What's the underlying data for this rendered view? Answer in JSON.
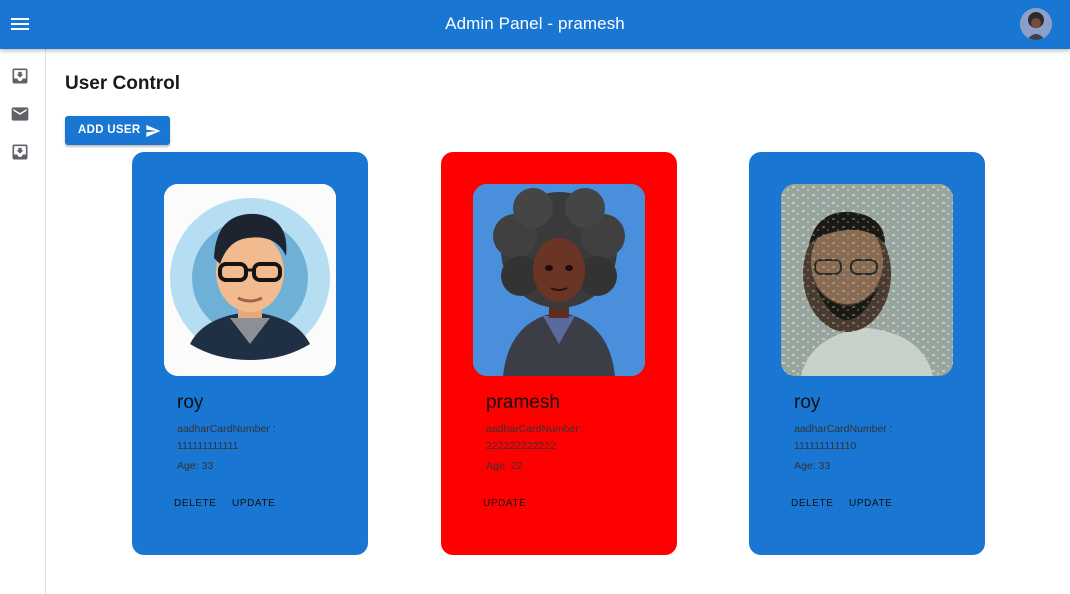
{
  "appbar": {
    "title": "Admin Panel - pramesh",
    "menu_icon": "hamburger-menu-icon",
    "avatar_icon": "user-avatar-icon",
    "color": "#1976d2"
  },
  "drawer": {
    "items": [
      {
        "icon": "move-to-inbox-icon"
      },
      {
        "icon": "mail-icon"
      },
      {
        "icon": "move-to-inbox-icon"
      }
    ]
  },
  "main": {
    "title": "User Control",
    "add_user_label": "ADD USER",
    "add_user_icon": "send-icon"
  },
  "users": [
    {
      "name": "roy",
      "aadhar_label": "aadharCardNumber :",
      "aadhar_value": "111111111111",
      "age_label": "Age:",
      "age": "33",
      "delete_label": "DELETE",
      "update_label": "UPDATE",
      "card_color": "#1976d2",
      "photo": "cartoon-man-glasses-avatar"
    },
    {
      "name": "pramesh",
      "aadhar_label": "aadharCardNumber :",
      "aadhar_value": "222222222222",
      "age_label": "Age:",
      "age": "22",
      "delete_label": "",
      "update_label": "UPDATE",
      "card_color": "#ff0000",
      "photo": "3d-woman-afro-avatar"
    },
    {
      "name": "roy",
      "aadhar_label": "aadharCardNumber :",
      "aadhar_value": "111111111110",
      "age_label": "Age:",
      "age": "33",
      "delete_label": "DELETE",
      "update_label": "UPDATE",
      "card_color": "#1976d2",
      "photo": "man-with-code-projection-photo"
    }
  ]
}
